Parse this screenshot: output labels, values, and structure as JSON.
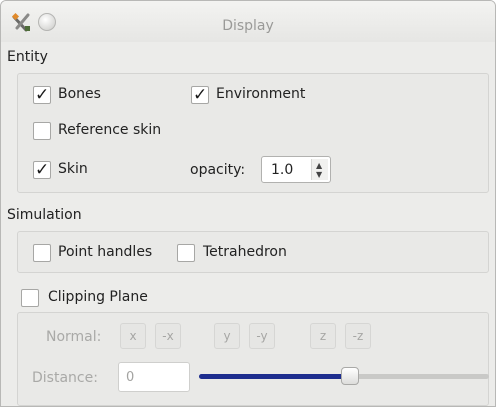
{
  "window": {
    "title": "Display"
  },
  "entity": {
    "label": "Entity",
    "bones": {
      "label": "Bones",
      "checked": true
    },
    "environment": {
      "label": "Environment",
      "checked": true
    },
    "reference_skin": {
      "label": "Reference skin",
      "checked": false
    },
    "skin": {
      "label": "Skin",
      "checked": true
    },
    "opacity": {
      "label": "opacity:",
      "value": "1.0"
    }
  },
  "simulation": {
    "label": "Simulation",
    "point_handles": {
      "label": "Point handles",
      "checked": false
    },
    "tetrahedron": {
      "label": "Tetrahedron",
      "checked": false
    }
  },
  "clipping": {
    "label": "Clipping Plane",
    "checked": false,
    "normal_label": "Normal:",
    "buttons": [
      "x",
      "-x",
      "y",
      "-y",
      "z",
      "-z"
    ],
    "distance_label": "Distance:",
    "distance_value": "0",
    "slider_fraction": 0.52
  },
  "colors": {
    "slider_fill": "#1d2d8e",
    "window_bg": "#ececea"
  },
  "icons": {
    "titlebar_tools": "tools-icon",
    "titlebar_close": "circle-button-icon",
    "check": "checkmark-icon"
  }
}
